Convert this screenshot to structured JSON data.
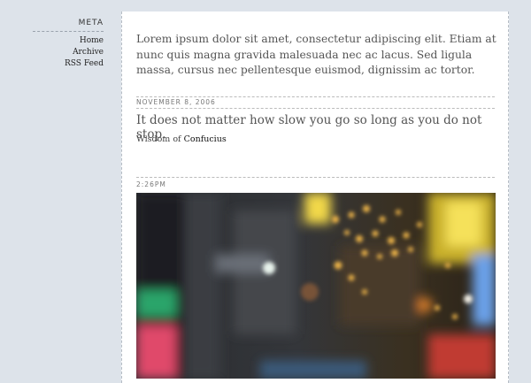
{
  "sidebar": {
    "heading": "META",
    "links": [
      "Home",
      "Archive",
      "RSS Feed"
    ]
  },
  "post": {
    "intro": "Lorem ipsum dolor sit amet, consectetur adipiscing elit. Etiam at nunc quis magna gravida malesuada nec ac lacus. Sed ligula massa, cursus nec pellentesque euismod, dignissim ac tortor.",
    "date": "NOVEMBER 8, 2006",
    "quote": "It does not matter how slow you go so long as you do not stop.",
    "attribution_prefix": "Wisdom of",
    "attribution_name": "Confucius",
    "time": "2:26PM"
  },
  "colors": {
    "background": "#dde3ea",
    "content": "#ffffff",
    "text": "#555555",
    "link": "#111111"
  }
}
